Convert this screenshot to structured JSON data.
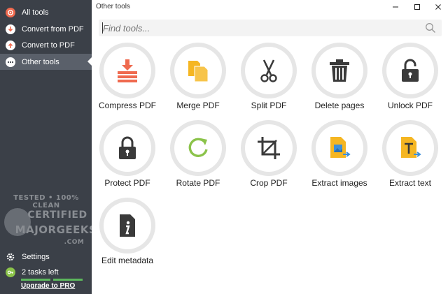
{
  "sidebar": {
    "items": [
      {
        "label": "All tools",
        "icon": "all-tools-icon"
      },
      {
        "label": "Convert from PDF",
        "icon": "convert-from-pdf-icon"
      },
      {
        "label": "Convert to PDF",
        "icon": "convert-to-pdf-icon"
      },
      {
        "label": "Other tools",
        "icon": "more-icon",
        "active": true
      }
    ],
    "settings_label": "Settings",
    "tasks_label": "2 tasks left",
    "upgrade_label": "Upgrade to PRO"
  },
  "watermark": {
    "line1": "TESTED • 100% CLEAN",
    "line2": "CERTIFIED",
    "line3": "MAJORGEEKS",
    "line4": ".COM"
  },
  "window": {
    "title": "Other tools",
    "minimize_icon": "minimize-icon",
    "maximize_icon": "maximize-icon",
    "close_icon": "close-icon"
  },
  "search": {
    "placeholder": "Find tools..."
  },
  "tools": [
    {
      "label": "Compress PDF",
      "icon": "compress-icon"
    },
    {
      "label": "Merge PDF",
      "icon": "merge-icon"
    },
    {
      "label": "Split PDF",
      "icon": "scissors-icon"
    },
    {
      "label": "Delete pages",
      "icon": "trash-icon"
    },
    {
      "label": "Unlock PDF",
      "icon": "unlock-icon"
    },
    {
      "label": "Protect PDF",
      "icon": "lock-icon"
    },
    {
      "label": "Rotate PDF",
      "icon": "rotate-icon"
    },
    {
      "label": "Crop PDF",
      "icon": "crop-icon"
    },
    {
      "label": "Extract images",
      "icon": "extract-images-icon"
    },
    {
      "label": "Extract text",
      "icon": "extract-text-icon"
    },
    {
      "label": "Edit metadata",
      "icon": "metadata-icon"
    }
  ],
  "colors": {
    "sidebar_bg": "#3b4048",
    "sidebar_active": "#5a606a",
    "accent_red": "#ef6a4f",
    "accent_orange": "#f5b622",
    "accent_green": "#8bc34a",
    "icon_dark": "#3a3a3a",
    "progress_green": "#5cb85c"
  }
}
